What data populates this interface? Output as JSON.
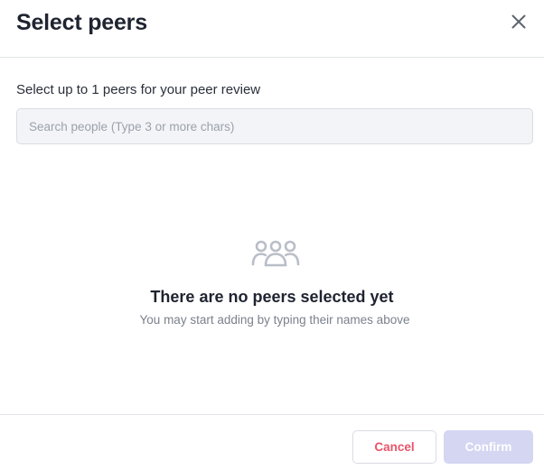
{
  "dialog": {
    "title": "Select peers",
    "close_icon": "close-icon"
  },
  "form": {
    "prompt": "Select up to 1 peers for your peer review",
    "search": {
      "placeholder": "Search people (Type 3 or more chars)",
      "value": ""
    }
  },
  "empty_state": {
    "icon": "people-group-icon",
    "title": "There are no peers selected yet",
    "subtitle": "You may start adding by typing their names above"
  },
  "footer": {
    "cancel_label": "Cancel",
    "confirm_label": "Confirm",
    "confirm_disabled": true
  },
  "colors": {
    "cancel_text": "#e8556b",
    "confirm_disabled_bg": "#d4d6f2",
    "icon_gray": "#b9bec8"
  }
}
